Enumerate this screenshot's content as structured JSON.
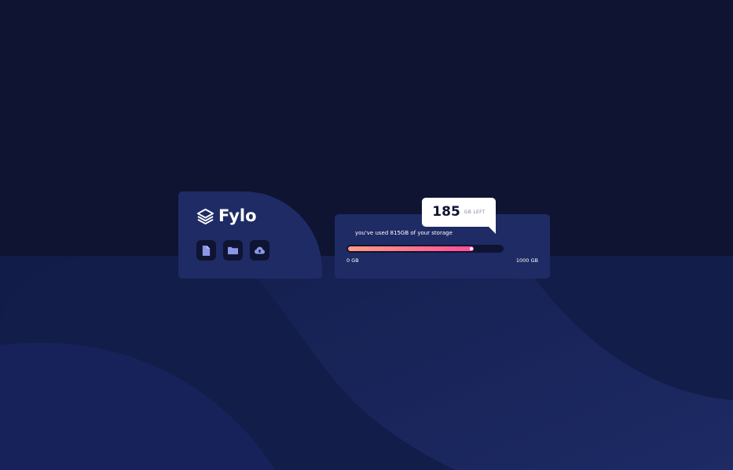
{
  "brand": {
    "name": "Fylo",
    "logo_icon": "layers-icon"
  },
  "toolbar": {
    "buttons": [
      {
        "icon": "document-icon"
      },
      {
        "icon": "folder-icon"
      },
      {
        "icon": "cloud-upload-icon"
      }
    ]
  },
  "storage": {
    "usage_prefix": "you've used ",
    "used_value": "815GB",
    "usage_suffix": " of your storage",
    "used_fraction": 0.815,
    "min_label": "0 GB",
    "max_label": "1000 GB",
    "remaining_number": "185",
    "remaining_unit": "GB LEFT"
  },
  "colors": {
    "background": "#0e1431",
    "card": "#1f2b65",
    "gradient_start": "#ff9d82",
    "gradient_end": "#ff4e98",
    "icon_accent": "#8b97e6"
  }
}
